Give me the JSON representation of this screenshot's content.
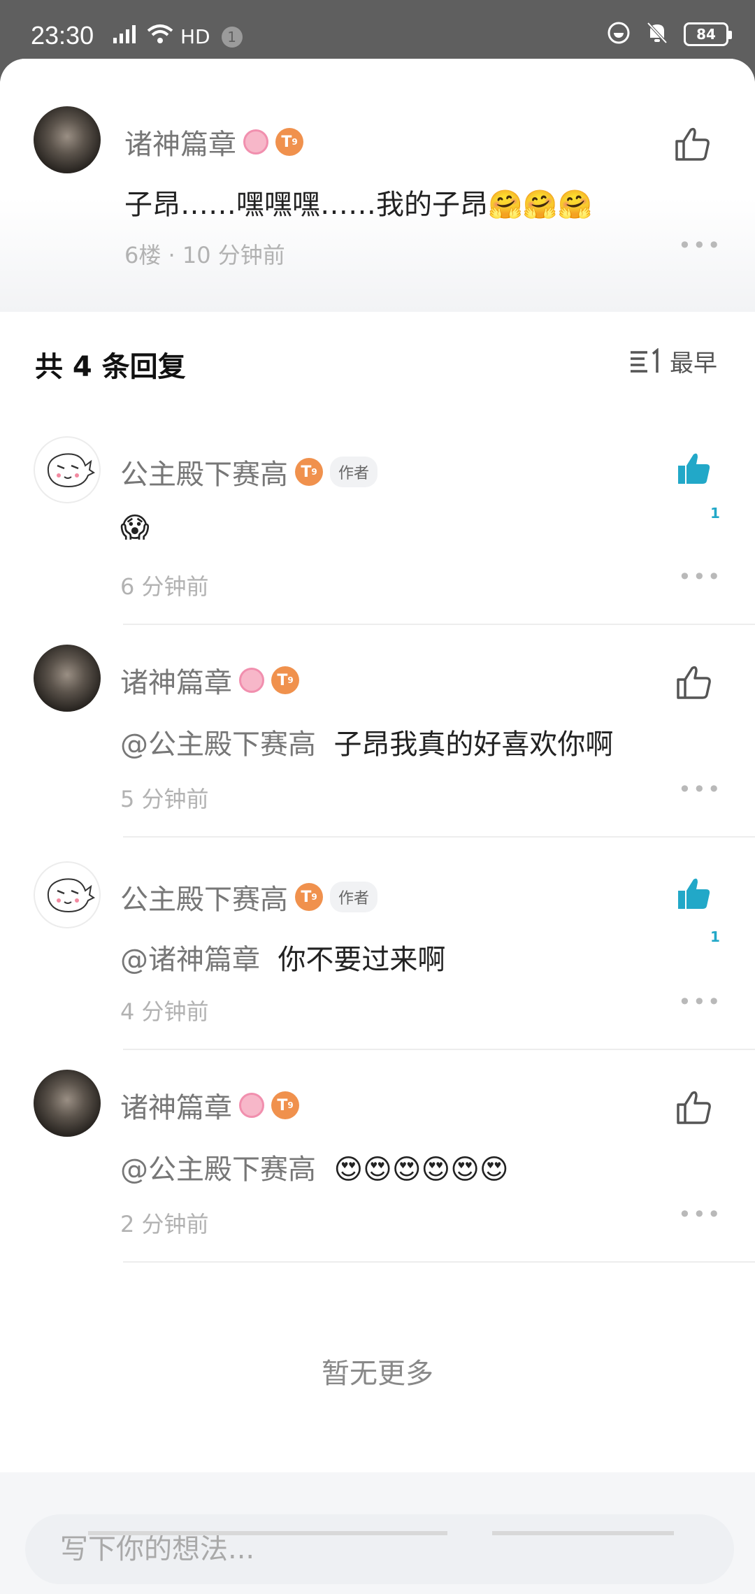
{
  "status_bar": {
    "time": "23:30",
    "network": "4G",
    "hd": "HD",
    "notification_count": "1",
    "battery": "84"
  },
  "main_comment": {
    "author": "诸神篇章",
    "text": "子昂……嘿嘿嘿……我的子昂🤗🤗🤗",
    "meta": "6楼 · 10 分钟前"
  },
  "replies_header": {
    "title": "共 4 条回复",
    "sort_label": "最早"
  },
  "replies": [
    {
      "author": "公主殿下赛高",
      "author_tag": "作者",
      "mention": "",
      "text": "😱",
      "time": "6 分钟前",
      "likes": "1"
    },
    {
      "author": "诸神篇章",
      "author_tag": "",
      "mention": "@公主殿下赛高",
      "text": "子昂我真的好喜欢你啊",
      "time": "5 分钟前",
      "likes": ""
    },
    {
      "author": "公主殿下赛高",
      "author_tag": "作者",
      "mention": "@诸神篇章",
      "text": "你不要过来啊",
      "time": "4 分钟前",
      "likes": "1"
    },
    {
      "author": "诸神篇章",
      "author_tag": "",
      "mention": "@公主殿下赛高",
      "text": "😍😍😍😍😍😍",
      "time": "2 分钟前",
      "likes": ""
    }
  ],
  "no_more": "暂无更多",
  "input": {
    "placeholder": "写下你的想法..."
  },
  "badges": {
    "level_glyph": "T",
    "level_sub": "9"
  },
  "colors": {
    "accent": "#22a8c8",
    "badge_orange": "#f0914d",
    "badge_pink": "#f18fae"
  }
}
